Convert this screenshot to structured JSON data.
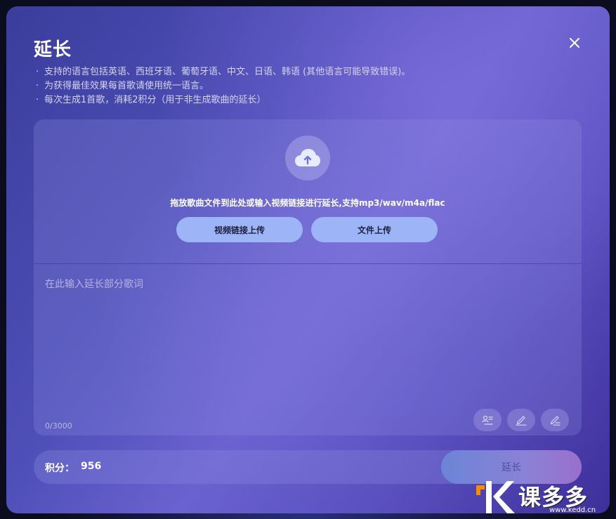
{
  "dialog": {
    "title": "延长",
    "close_icon": "close-icon",
    "notes": [
      "支持的语言包括英语、西班牙语、葡萄牙语、中文、日语、韩语 (其他语言可能导致错误)。",
      "为获得最佳效果每首歌请使用统一语言。",
      "每次生成1首歌，消耗2积分（用于非生成歌曲的延长）"
    ]
  },
  "upload": {
    "icon": "cloud-upload-icon",
    "hint": "拖放歌曲文件到此处或输入视频链接进行延长,支持mp3/wav/m4a/flac",
    "video_link_button": "视频链接上传",
    "file_button": "文件上传"
  },
  "lyrics": {
    "placeholder": "在此输入延长部分歌词",
    "value": "",
    "counter": "0/3000",
    "tools": [
      "lyrics-format-icon",
      "pen-icon",
      "pen-edit-icon"
    ]
  },
  "footer": {
    "credits_label": "积分：",
    "credits_value": "956",
    "submit_label": "延长"
  },
  "watermark": {
    "text": "课多多",
    "url": "www.kedd.cn"
  },
  "colors": {
    "button_fill": "#9db5f7",
    "watermark_orange": "#ff8a00"
  }
}
